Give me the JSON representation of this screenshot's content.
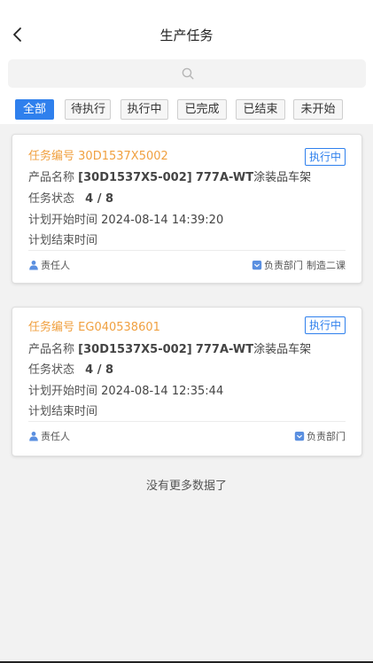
{
  "header": {
    "title": "生产任务"
  },
  "search": {
    "placeholder": ""
  },
  "tabs": [
    {
      "label": "全部",
      "active": true
    },
    {
      "label": "待执行",
      "active": false
    },
    {
      "label": "执行中",
      "active": false
    },
    {
      "label": "已完成",
      "active": false
    },
    {
      "label": "已结束",
      "active": false
    },
    {
      "label": "未开始",
      "active": false
    }
  ],
  "cards": [
    {
      "code_label": "任务编号",
      "code": "30D1537X5002",
      "status": "执行中",
      "product_label": "产品名称",
      "product_code": "[30D1537X5-002]",
      "product_model": "777A-WT",
      "product_name": "涂装品车架",
      "state_label": "任务状态",
      "state_value": "4 / 8",
      "start_label": "计划开始时间",
      "start_value": "2024-08-14 14:39:20",
      "end_label": "计划结束时间",
      "end_value": "",
      "owner_label": "责任人",
      "owner_value": "",
      "dept_label": "负责部门",
      "dept_value": "制造二课"
    },
    {
      "code_label": "任务编号",
      "code": "EG040538601",
      "status": "执行中",
      "product_label": "产品名称",
      "product_code": "[30D1537X5-002]",
      "product_model": "777A-WT",
      "product_name": "涂装品车架",
      "state_label": "任务状态",
      "state_value": "4 / 8",
      "start_label": "计划开始时间",
      "start_value": "2024-08-14 12:35:44",
      "end_label": "计划结束时间",
      "end_value": "",
      "owner_label": "责任人",
      "owner_value": "",
      "dept_label": "负责部门",
      "dept_value": ""
    }
  ],
  "footer_text": "没有更多数据了",
  "colors": {
    "accent": "#2f80ed",
    "code": "#f0a040",
    "background": "#f2f2f2"
  },
  "icons": {
    "back": "chevron-left-icon",
    "search": "search-icon",
    "owner": "user-icon",
    "dept": "department-icon"
  }
}
